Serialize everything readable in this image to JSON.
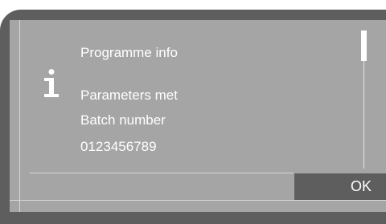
{
  "dialog": {
    "lines": [
      "Programme info",
      "Parameters met",
      "Batch number",
      "0123456789"
    ],
    "icon": "info-icon"
  },
  "buttons": {
    "ok_label": "OK"
  },
  "colors": {
    "screen": "#a5a5a5",
    "bezel": "#5e5e5e",
    "text": "#ffffff"
  }
}
